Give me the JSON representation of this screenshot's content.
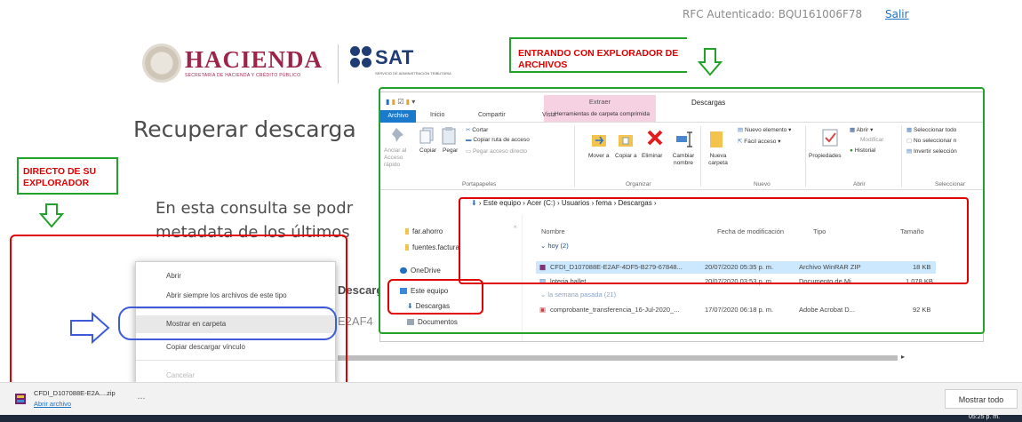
{
  "header": {
    "rfc_text": "RFC Autenticado: BQU161006F78",
    "logout_label": "Salir",
    "hacienda_label": "HACIENDA",
    "hacienda_subtitle": "SECRETARÍA DE HACIENDA Y CRÉDITO PÚBLICO",
    "sat_label": "SAT",
    "sat_subtitle": "SERVICIO DE ADMINISTRACIÓN TRIBUTARIA"
  },
  "page": {
    "title": "Recuperar descarga",
    "description_line1": "En esta consulta se podr",
    "description_line2": "metadata de los últimos",
    "descarga_fragment": "Descarg",
    "hash_fragment": "E2AF4"
  },
  "annotations": {
    "explorer_label": "ENTRANDO CON EXPLORADOR DE ARCHIVOS",
    "browser_label": "DIRECTO DE SU EXPLORADOR",
    "colors": {
      "red": "#e00000",
      "green": "#22a22a",
      "blue": "#3d5bd8"
    }
  },
  "context_menu": {
    "items": [
      {
        "label": "Abrir",
        "disabled": false
      },
      {
        "label": "Abrir siempre los archivos de este tipo",
        "disabled": false
      },
      {
        "label": "Mostrar en carpeta",
        "disabled": false,
        "highlighted": true
      },
      {
        "label": "Copiar descargar vínculo",
        "disabled": false
      },
      {
        "label": "Cancelar",
        "disabled": true
      }
    ]
  },
  "download_bar": {
    "file_name": "CFDI_D107088E-E2A....zip",
    "open_label": "Abrir archivo",
    "more_label": "...",
    "show_all_label": "Mostrar todo",
    "clock": "05:25 p. m."
  },
  "explorer": {
    "title": "Descargas",
    "extract_tab": "Extraer",
    "tools_tab": "Herramientas de carpeta comprimida",
    "tabs": [
      "Archivo",
      "Inicio",
      "Compartir",
      "Vista"
    ],
    "ribbon": {
      "pin_label": "Anclar al Acceso rápido",
      "copy_label": "Copiar",
      "paste_label": "Pegar",
      "cut_label": "Cortar",
      "copy_path_label": "Copiar ruta de acceso",
      "paste_shortcut_label": "Pegar acceso directo",
      "move_label": "Mover a",
      "copyto_label": "Copiar a",
      "delete_label": "Eliminar",
      "rename_label": "Cambiar nombre",
      "new_folder_label": "Nueva carpeta",
      "new_item_label": "Nuevo elemento",
      "easy_access_label": "Fácil acceso",
      "properties_label": "Propiedades",
      "open_label": "Abrir",
      "modify_label": "Modificar",
      "history_label": "Historial",
      "select_all_label": "Seleccionar todo",
      "select_none_label": "No seleccionar n",
      "invert_label": "Invertir selección",
      "groups": [
        "Portapapeles",
        "Organizar",
        "Nuevo",
        "Abrir",
        "Seleccionar"
      ]
    },
    "address": {
      "segments": [
        "Este equipo",
        "Acer (C:)",
        "Usuarios",
        "fema",
        "Descargas"
      ]
    },
    "nav": {
      "items": [
        "far.ahorro",
        "fuentes.factura",
        "OneDrive",
        "Este equipo",
        "Descargas",
        "Documentos"
      ]
    },
    "columns": [
      "Nombre",
      "Fecha de modificación",
      "Tipo",
      "Tamaño"
    ],
    "groups": [
      "hoy (2)",
      "la semana pasada (21)"
    ],
    "files": [
      {
        "name": "CFDI_D107088E-E2AF-4DF5-B279-67848...",
        "date": "20/07/2020 05:35 p. m.",
        "type": "Archivo WinRAR ZIP",
        "size": "18 KB",
        "selected": true
      },
      {
        "name": "loteria ballet",
        "date": "20/07/2020 03:53 p. m.",
        "type": "Documento de Mi...",
        "size": "1,078 KB",
        "selected": false
      },
      {
        "name": "comprobante_transferencia_16-Jul-2020_...",
        "date": "17/07/2020 06:18 p. m.",
        "type": "Adobe Acrobat D...",
        "size": "92 KB",
        "selected": false
      }
    ]
  }
}
